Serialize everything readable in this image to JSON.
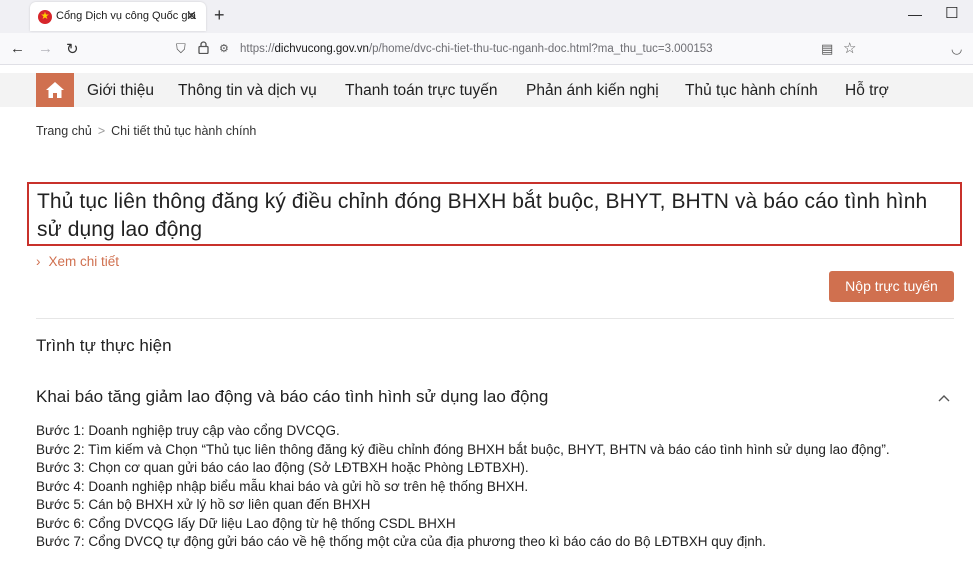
{
  "browser": {
    "tab_title": "Cổng Dịch vụ công Quốc gia",
    "url_prefix": "https://",
    "url_host": "dichvucong.gov.vn",
    "url_path": "/p/home/dvc-chi-tiet-thu-tuc-nganh-doc.html?ma_thu_tuc=3.000153"
  },
  "menu": {
    "items": [
      "Giới thiệu",
      "Thông tin và dịch vụ",
      "Thanh toán trực tuyến",
      "Phản ánh kiến nghị",
      "Thủ tục hành chính",
      "Hỗ trợ"
    ]
  },
  "breadcrumb": {
    "home": "Trang chủ",
    "current": "Chi tiết thủ tục hành chính"
  },
  "procedure": {
    "title": "Thủ tục liên thông đăng ký điều chỉnh đóng BHXH bắt buộc, BHYT, BHTN và báo cáo tình hình sử dụng lao động",
    "detail_link": "Xem chi tiết",
    "submit_label": "Nộp trực tuyến"
  },
  "sequence": {
    "section_title": "Trình tự thực hiện",
    "sub_title": "Khai báo tăng giảm lao động và báo cáo tình hình sử dụng lao động",
    "steps": [
      "Bước 1: Doanh nghiệp truy cập vào cổng DVCQG.",
      "Bước 2: Tìm kiếm và Chọn “Thủ tục liên thông đăng ký điều chỉnh đóng BHXH bắt buộc, BHYT, BHTN và báo cáo tình hình sử dụng lao động”.",
      "Bước 3: Chọn cơ quan gửi báo cáo lao động (Sở LĐTBXH hoặc Phòng LĐTBXH).",
      "Bước 4: Doanh nghiệp nhập biểu mẫu khai báo và gửi hồ sơ trên hệ thống BHXH.",
      "Bước 5: Cán bộ BHXH xử lý hồ sơ liên quan đến BHXH",
      "Bước 6: Cổng DVCQG lấy Dữ liệu Lao động từ hệ thống CSDL BHXH",
      "Bước 7: Cổng DVCQ tự động gửi báo cáo về hệ thống một cửa của địa phương theo kì báo cáo do Bộ LĐTBXH quy định."
    ]
  },
  "colors": {
    "accent": "#d0704f",
    "title_border": "#c8312b"
  },
  "icons": {
    "home": "home-icon",
    "favicon": "national-emblem-icon",
    "collapse": "chevron-up-icon"
  }
}
